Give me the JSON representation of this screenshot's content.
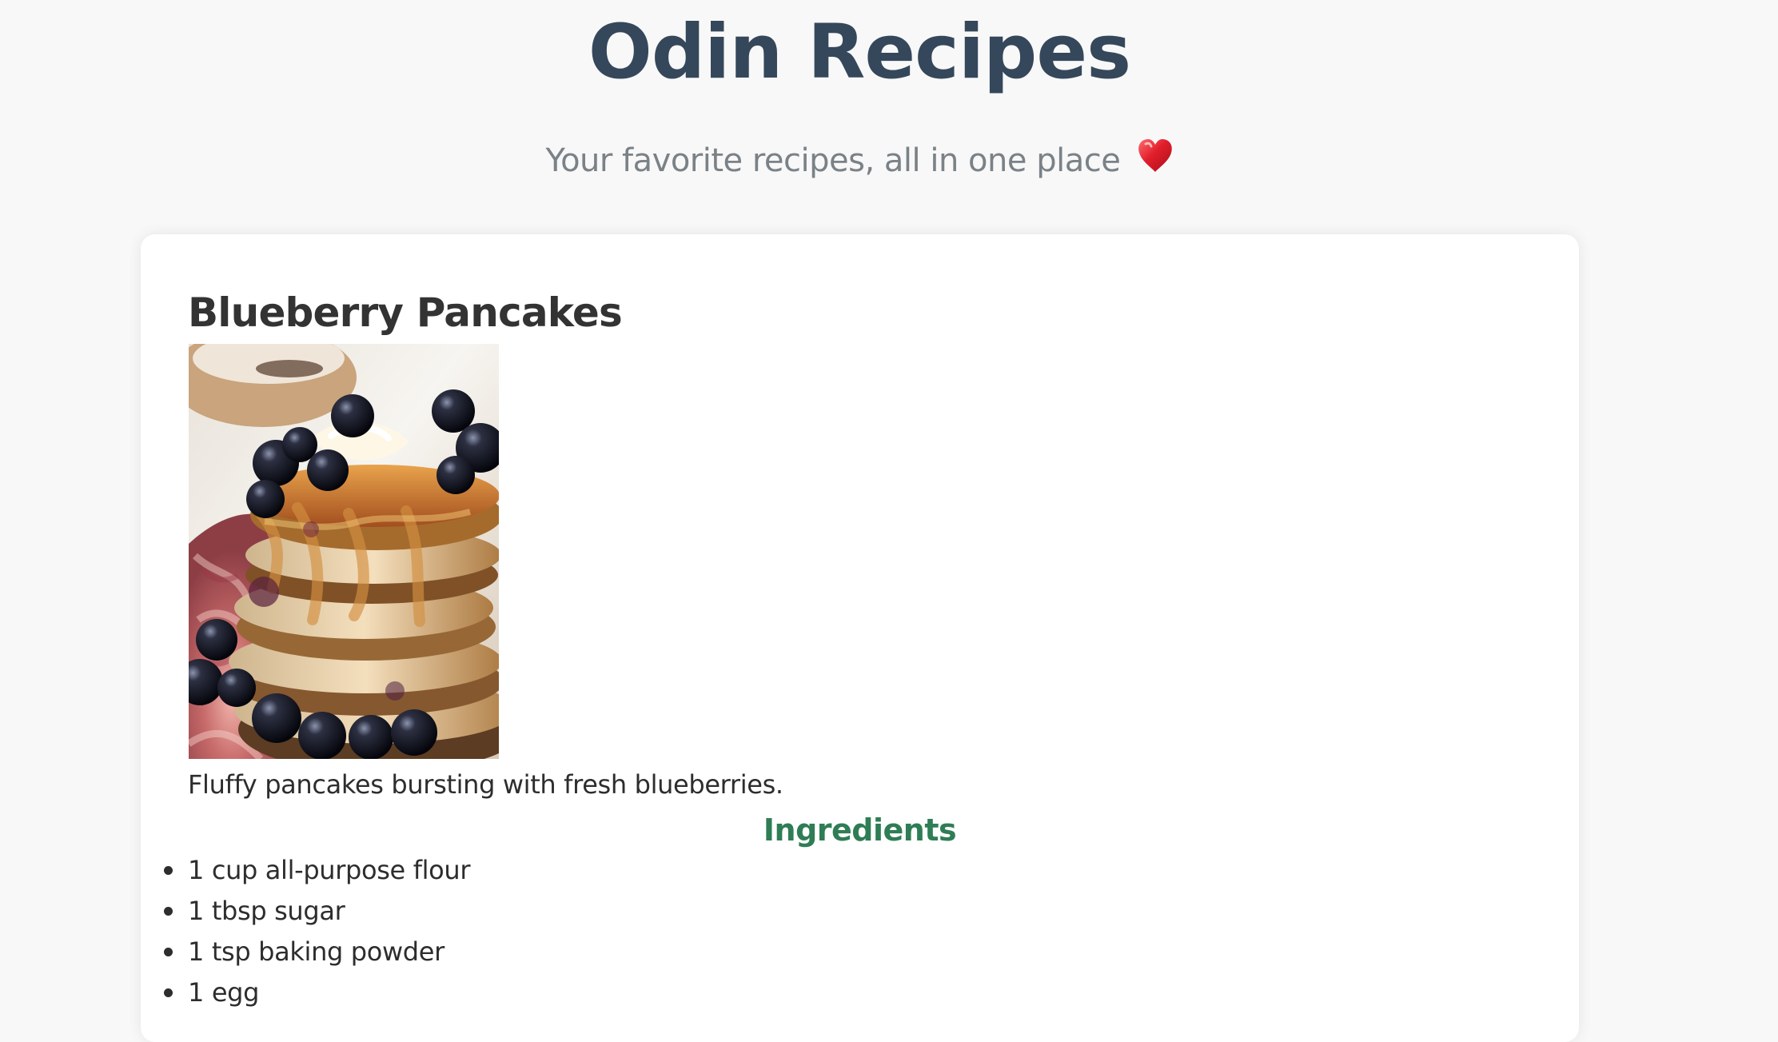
{
  "header": {
    "title": "Odin Recipes",
    "tagline": "Your favorite recipes, all in one place"
  },
  "recipe": {
    "title": "Blueberry Pancakes",
    "image_alt": "Stack of blueberry pancakes",
    "description": "Fluffy pancakes bursting with fresh blueberries.",
    "ingredients_heading": "Ingredients",
    "ingredients": [
      "1 cup all-purpose flour",
      "1 tbsp sugar",
      "1 tsp baking powder",
      "1 egg"
    ]
  },
  "colors": {
    "page_background": "#f8f8f8",
    "title": "#35475b",
    "tagline": "#7a8287",
    "ingredients_heading": "#2f7d55",
    "heart": "#e01e2b"
  },
  "icons": {
    "heart": "heart-icon",
    "bullet": "bullet-icon"
  }
}
